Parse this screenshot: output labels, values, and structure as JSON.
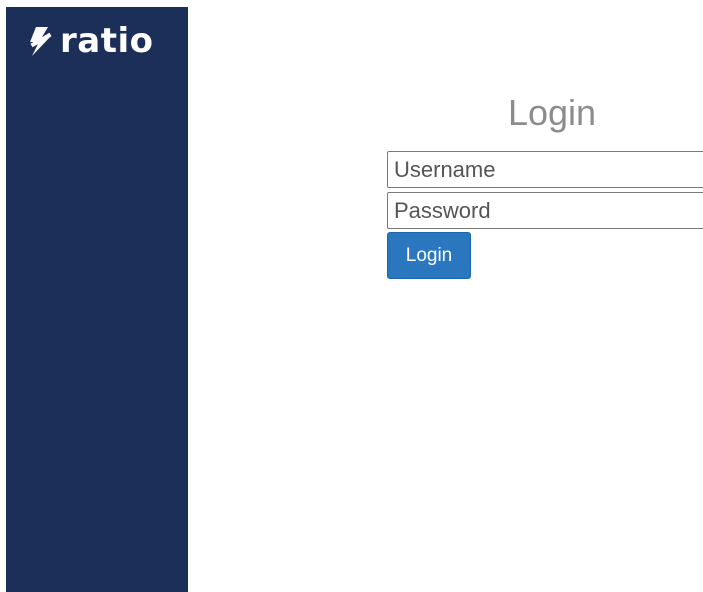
{
  "brand": {
    "name": "ratio",
    "color": "#1c2f59"
  },
  "login": {
    "title": "Login",
    "username_placeholder": "Username",
    "password_placeholder": "Password",
    "button_label": "Login",
    "button_color": "#2a77c0"
  }
}
